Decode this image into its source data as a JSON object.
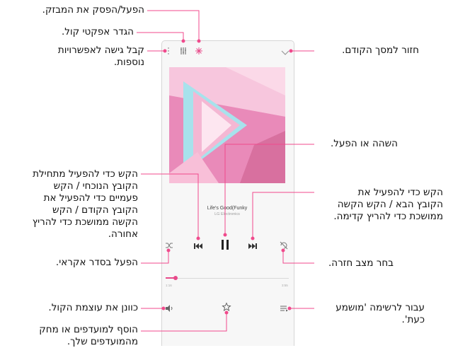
{
  "player": {
    "song_title": "Life's Good(Funky",
    "artist": "LG Electronics",
    "elapsed": "1:16",
    "total": "3:55",
    "progress": 0.08
  },
  "icons": {
    "back": "chevron-down-icon",
    "more": "more-options-icon",
    "equalizer": "equalizer-icon",
    "visualizer": "visualizer-icon",
    "shuffle": "shuffle-icon",
    "previous": "skip-previous-icon",
    "pause": "pause-icon",
    "next": "skip-next-icon",
    "repeat": "repeat-icon",
    "volume": "volume-icon",
    "favorite": "star-icon",
    "playlist": "playlist-icon"
  },
  "callouts": {
    "visualizer": [
      "הפעל/הפסק את המבזק."
    ],
    "equalizer": [
      "הגדר אפקטי קול."
    ],
    "more": [
      "קבל גישה לאפשרויות",
      "נוספות."
    ],
    "back": [
      "חזור למסך הקודם."
    ],
    "pause": [
      "השהה או הפעל."
    ],
    "previous": [
      "הקש כדי להפעיל מתחילת",
      "הקובץ הנוכחי / הקש",
      "פעמיים כדי להפעיל את",
      "הקובץ הקודם / הקש",
      "הקשה ממושכת כדי להריץ",
      "אחורה."
    ],
    "next": [
      "הקש כדי להפעיל את",
      "הקובץ הבא / הקש הקשה",
      "ממושכת כדי להריץ קדימה."
    ],
    "shuffle": [
      "הפעל בסדר אקראי."
    ],
    "repeat": [
      "בחר מצב חזרה."
    ],
    "volume": [
      "כוונן את עוצמת הקול."
    ],
    "playlist": [
      "עבור לרשימה 'מושמע",
      "כעת'."
    ],
    "favorite": [
      "הוסף למועדפים או מחק",
      "מהמועדפים שלך."
    ]
  },
  "colors": {
    "callout_line": "#f04a8c",
    "accent": "#e84a8a"
  }
}
